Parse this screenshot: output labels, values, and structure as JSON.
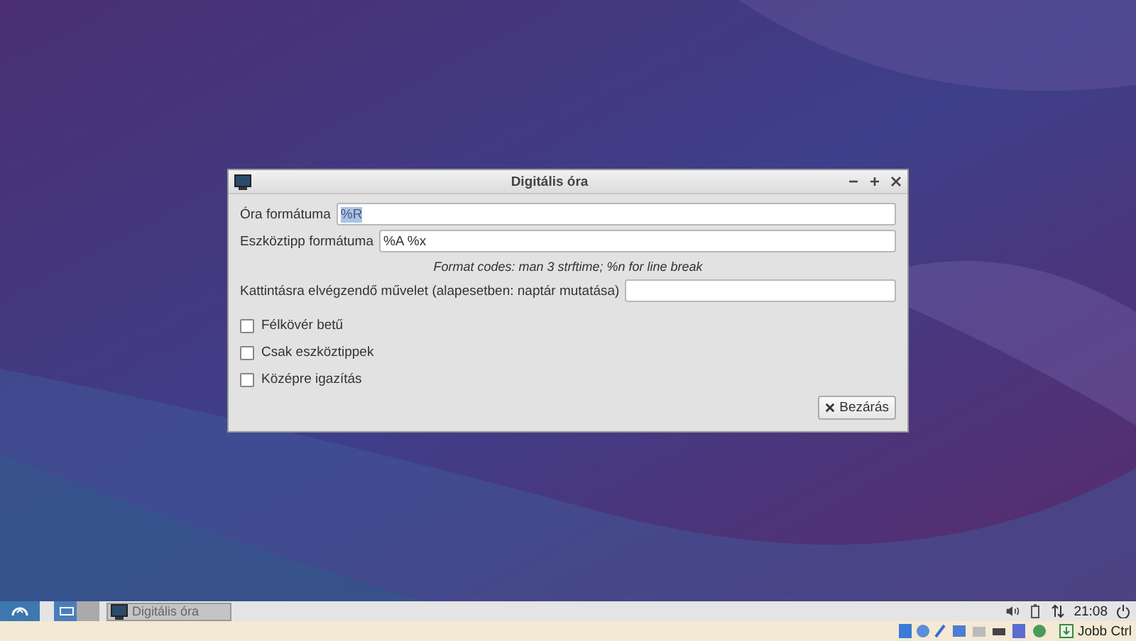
{
  "window": {
    "title": "Digitális óra"
  },
  "fields": [
    {
      "label": "Óra formátuma",
      "value": "%R",
      "text_selected": true
    },
    {
      "label": "Eszköztipp formátuma",
      "value": "%A %x",
      "text_selected": false
    }
  ],
  "hint": "Format codes: man 3 strftime; %n for line break",
  "action_field": {
    "label": "Kattintásra elvégzendő művelet (alapesetben: naptár mutatása)"
  },
  "checkboxes": [
    {
      "label": "Félkövér betű",
      "checked": false
    },
    {
      "label": "Csak eszköztippek",
      "checked": false
    },
    {
      "label": "Középre igazítás",
      "checked": false
    }
  ],
  "close_button": "Bezárás",
  "taskbar": {
    "tasks": [
      {
        "label": "Digitális óra",
        "selected": true
      }
    ],
    "clock": "21:08"
  },
  "status_bar": {
    "host_key": "Jobb Ctrl"
  }
}
